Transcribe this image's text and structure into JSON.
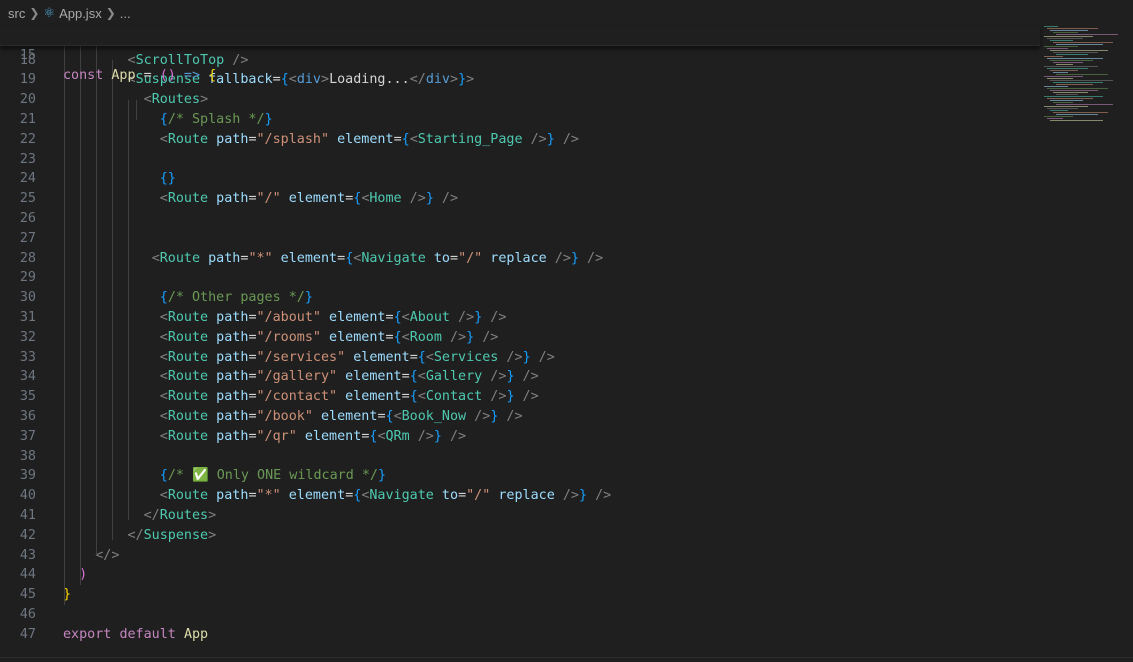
{
  "breadcrumb": {
    "folder": "src",
    "file": "App.jsx",
    "more": "...",
    "file_icon": "react-icon"
  },
  "sticky": {
    "number": "15",
    "tokens": [
      {
        "t": "const ",
        "c": "kw2"
      },
      {
        "t": "App",
        "c": "id"
      },
      {
        "t": " = ",
        "c": "txt"
      },
      {
        "t": "()",
        "c": "b2"
      },
      {
        "t": " => ",
        "c": "kw"
      },
      {
        "t": "{",
        "c": "b1"
      }
    ]
  },
  "lines": [
    {
      "n": "18",
      "tokens": [
        {
          "t": "        ",
          "c": "txt"
        },
        {
          "t": "<",
          "c": "tag"
        },
        {
          "t": "ScrollToTop",
          "c": "comp"
        },
        {
          "t": " />",
          "c": "tag"
        }
      ]
    },
    {
      "n": "19",
      "tokens": [
        {
          "t": "        ",
          "c": "txt"
        },
        {
          "t": "<",
          "c": "tag"
        },
        {
          "t": "Suspense",
          "c": "comp"
        },
        {
          "t": " fallback",
          "c": "attr"
        },
        {
          "t": "=",
          "c": "txt"
        },
        {
          "t": "{",
          "c": "b3"
        },
        {
          "t": "<",
          "c": "tag"
        },
        {
          "t": "div",
          "c": "kw"
        },
        {
          "t": ">",
          "c": "tag"
        },
        {
          "t": "Loading...",
          "c": "txt"
        },
        {
          "t": "</",
          "c": "tag"
        },
        {
          "t": "div",
          "c": "kw"
        },
        {
          "t": ">",
          "c": "tag"
        },
        {
          "t": "}",
          "c": "b3"
        },
        {
          "t": ">",
          "c": "tag"
        }
      ]
    },
    {
      "n": "20",
      "tokens": [
        {
          "t": "          ",
          "c": "txt"
        },
        {
          "t": "<",
          "c": "tag"
        },
        {
          "t": "Routes",
          "c": "comp"
        },
        {
          "t": ">",
          "c": "tag"
        }
      ]
    },
    {
      "n": "21",
      "tokens": [
        {
          "t": "            ",
          "c": "txt"
        },
        {
          "t": "{",
          "c": "b3"
        },
        {
          "t": "/* Splash */",
          "c": "cmt"
        },
        {
          "t": "}",
          "c": "b3"
        }
      ]
    },
    {
      "n": "22",
      "tokens": [
        {
          "t": "            ",
          "c": "txt"
        },
        {
          "t": "<",
          "c": "tag"
        },
        {
          "t": "Route",
          "c": "comp"
        },
        {
          "t": " path",
          "c": "attr"
        },
        {
          "t": "=",
          "c": "txt"
        },
        {
          "t": "\"/splash\"",
          "c": "str"
        },
        {
          "t": " element",
          "c": "attr"
        },
        {
          "t": "=",
          "c": "txt"
        },
        {
          "t": "{",
          "c": "b3"
        },
        {
          "t": "<",
          "c": "tag"
        },
        {
          "t": "Starting_Page",
          "c": "comp"
        },
        {
          "t": " />",
          "c": "tag"
        },
        {
          "t": "}",
          "c": "b3"
        },
        {
          "t": " />",
          "c": "tag"
        }
      ]
    },
    {
      "n": "23",
      "tokens": []
    },
    {
      "n": "24",
      "tokens": [
        {
          "t": "            ",
          "c": "txt"
        },
        {
          "t": "{}",
          "c": "b3"
        }
      ]
    },
    {
      "n": "25",
      "tokens": [
        {
          "t": "            ",
          "c": "txt"
        },
        {
          "t": "<",
          "c": "tag"
        },
        {
          "t": "Route",
          "c": "comp"
        },
        {
          "t": " path",
          "c": "attr"
        },
        {
          "t": "=",
          "c": "txt"
        },
        {
          "t": "\"/\"",
          "c": "str"
        },
        {
          "t": " element",
          "c": "attr"
        },
        {
          "t": "=",
          "c": "txt"
        },
        {
          "t": "{",
          "c": "b3"
        },
        {
          "t": "<",
          "c": "tag"
        },
        {
          "t": "Home",
          "c": "comp"
        },
        {
          "t": " />",
          "c": "tag"
        },
        {
          "t": "}",
          "c": "b3"
        },
        {
          "t": " />",
          "c": "tag"
        }
      ]
    },
    {
      "n": "26",
      "tokens": []
    },
    {
      "n": "27",
      "tokens": []
    },
    {
      "n": "28",
      "tokens": [
        {
          "t": "           ",
          "c": "txt"
        },
        {
          "t": "<",
          "c": "tag"
        },
        {
          "t": "Route",
          "c": "comp"
        },
        {
          "t": " path",
          "c": "attr"
        },
        {
          "t": "=",
          "c": "txt"
        },
        {
          "t": "\"*\"",
          "c": "str"
        },
        {
          "t": " element",
          "c": "attr"
        },
        {
          "t": "=",
          "c": "txt"
        },
        {
          "t": "{",
          "c": "b3"
        },
        {
          "t": "<",
          "c": "tag"
        },
        {
          "t": "Navigate",
          "c": "comp"
        },
        {
          "t": " to",
          "c": "attr"
        },
        {
          "t": "=",
          "c": "txt"
        },
        {
          "t": "\"/\"",
          "c": "str"
        },
        {
          "t": " replace",
          "c": "attr"
        },
        {
          "t": " />",
          "c": "tag"
        },
        {
          "t": "}",
          "c": "b3"
        },
        {
          "t": " />",
          "c": "tag"
        }
      ]
    },
    {
      "n": "29",
      "tokens": []
    },
    {
      "n": "30",
      "tokens": [
        {
          "t": "            ",
          "c": "txt"
        },
        {
          "t": "{",
          "c": "b3"
        },
        {
          "t": "/* Other pages */",
          "c": "cmt"
        },
        {
          "t": "}",
          "c": "b3"
        }
      ]
    },
    {
      "n": "31",
      "tokens": [
        {
          "t": "            ",
          "c": "txt"
        },
        {
          "t": "<",
          "c": "tag"
        },
        {
          "t": "Route",
          "c": "comp"
        },
        {
          "t": " path",
          "c": "attr"
        },
        {
          "t": "=",
          "c": "txt"
        },
        {
          "t": "\"/about\"",
          "c": "str"
        },
        {
          "t": " element",
          "c": "attr"
        },
        {
          "t": "=",
          "c": "txt"
        },
        {
          "t": "{",
          "c": "b3"
        },
        {
          "t": "<",
          "c": "tag"
        },
        {
          "t": "About",
          "c": "comp"
        },
        {
          "t": " />",
          "c": "tag"
        },
        {
          "t": "}",
          "c": "b3"
        },
        {
          "t": " />",
          "c": "tag"
        }
      ]
    },
    {
      "n": "32",
      "tokens": [
        {
          "t": "            ",
          "c": "txt"
        },
        {
          "t": "<",
          "c": "tag"
        },
        {
          "t": "Route",
          "c": "comp"
        },
        {
          "t": " path",
          "c": "attr"
        },
        {
          "t": "=",
          "c": "txt"
        },
        {
          "t": "\"/rooms\"",
          "c": "str"
        },
        {
          "t": " element",
          "c": "attr"
        },
        {
          "t": "=",
          "c": "txt"
        },
        {
          "t": "{",
          "c": "b3"
        },
        {
          "t": "<",
          "c": "tag"
        },
        {
          "t": "Room",
          "c": "comp"
        },
        {
          "t": " />",
          "c": "tag"
        },
        {
          "t": "}",
          "c": "b3"
        },
        {
          "t": " />",
          "c": "tag"
        }
      ]
    },
    {
      "n": "33",
      "tokens": [
        {
          "t": "            ",
          "c": "txt"
        },
        {
          "t": "<",
          "c": "tag"
        },
        {
          "t": "Route",
          "c": "comp"
        },
        {
          "t": " path",
          "c": "attr"
        },
        {
          "t": "=",
          "c": "txt"
        },
        {
          "t": "\"/services\"",
          "c": "str"
        },
        {
          "t": " element",
          "c": "attr"
        },
        {
          "t": "=",
          "c": "txt"
        },
        {
          "t": "{",
          "c": "b3"
        },
        {
          "t": "<",
          "c": "tag"
        },
        {
          "t": "Services",
          "c": "comp"
        },
        {
          "t": " />",
          "c": "tag"
        },
        {
          "t": "}",
          "c": "b3"
        },
        {
          "t": " />",
          "c": "tag"
        }
      ]
    },
    {
      "n": "34",
      "tokens": [
        {
          "t": "            ",
          "c": "txt"
        },
        {
          "t": "<",
          "c": "tag"
        },
        {
          "t": "Route",
          "c": "comp"
        },
        {
          "t": " path",
          "c": "attr"
        },
        {
          "t": "=",
          "c": "txt"
        },
        {
          "t": "\"/gallery\"",
          "c": "str"
        },
        {
          "t": " element",
          "c": "attr"
        },
        {
          "t": "=",
          "c": "txt"
        },
        {
          "t": "{",
          "c": "b3"
        },
        {
          "t": "<",
          "c": "tag"
        },
        {
          "t": "Gallery",
          "c": "comp"
        },
        {
          "t": " />",
          "c": "tag"
        },
        {
          "t": "}",
          "c": "b3"
        },
        {
          "t": " />",
          "c": "tag"
        }
      ]
    },
    {
      "n": "35",
      "tokens": [
        {
          "t": "            ",
          "c": "txt"
        },
        {
          "t": "<",
          "c": "tag"
        },
        {
          "t": "Route",
          "c": "comp"
        },
        {
          "t": " path",
          "c": "attr"
        },
        {
          "t": "=",
          "c": "txt"
        },
        {
          "t": "\"/contact\"",
          "c": "str"
        },
        {
          "t": " element",
          "c": "attr"
        },
        {
          "t": "=",
          "c": "txt"
        },
        {
          "t": "{",
          "c": "b3"
        },
        {
          "t": "<",
          "c": "tag"
        },
        {
          "t": "Contact",
          "c": "comp"
        },
        {
          "t": " />",
          "c": "tag"
        },
        {
          "t": "}",
          "c": "b3"
        },
        {
          "t": " />",
          "c": "tag"
        }
      ]
    },
    {
      "n": "36",
      "tokens": [
        {
          "t": "            ",
          "c": "txt"
        },
        {
          "t": "<",
          "c": "tag"
        },
        {
          "t": "Route",
          "c": "comp"
        },
        {
          "t": " path",
          "c": "attr"
        },
        {
          "t": "=",
          "c": "txt"
        },
        {
          "t": "\"/book\"",
          "c": "str"
        },
        {
          "t": " element",
          "c": "attr"
        },
        {
          "t": "=",
          "c": "txt"
        },
        {
          "t": "{",
          "c": "b3"
        },
        {
          "t": "<",
          "c": "tag"
        },
        {
          "t": "Book_Now",
          "c": "comp"
        },
        {
          "t": " />",
          "c": "tag"
        },
        {
          "t": "}",
          "c": "b3"
        },
        {
          "t": " />",
          "c": "tag"
        }
      ]
    },
    {
      "n": "37",
      "tokens": [
        {
          "t": "            ",
          "c": "txt"
        },
        {
          "t": "<",
          "c": "tag"
        },
        {
          "t": "Route",
          "c": "comp"
        },
        {
          "t": " path",
          "c": "attr"
        },
        {
          "t": "=",
          "c": "txt"
        },
        {
          "t": "\"/qr\"",
          "c": "str"
        },
        {
          "t": " element",
          "c": "attr"
        },
        {
          "t": "=",
          "c": "txt"
        },
        {
          "t": "{",
          "c": "b3"
        },
        {
          "t": "<",
          "c": "tag"
        },
        {
          "t": "QRm",
          "c": "comp"
        },
        {
          "t": " />",
          "c": "tag"
        },
        {
          "t": "}",
          "c": "b3"
        },
        {
          "t": " />",
          "c": "tag"
        }
      ]
    },
    {
      "n": "38",
      "tokens": []
    },
    {
      "n": "39",
      "tokens": [
        {
          "t": "            ",
          "c": "txt"
        },
        {
          "t": "{",
          "c": "b3"
        },
        {
          "t": "/* ✅ Only ONE wildcard */",
          "c": "cmt"
        },
        {
          "t": "}",
          "c": "b3"
        }
      ]
    },
    {
      "n": "40",
      "tokens": [
        {
          "t": "            ",
          "c": "txt"
        },
        {
          "t": "<",
          "c": "tag"
        },
        {
          "t": "Route",
          "c": "comp"
        },
        {
          "t": " path",
          "c": "attr"
        },
        {
          "t": "=",
          "c": "txt"
        },
        {
          "t": "\"*\"",
          "c": "str"
        },
        {
          "t": " element",
          "c": "attr"
        },
        {
          "t": "=",
          "c": "txt"
        },
        {
          "t": "{",
          "c": "b3"
        },
        {
          "t": "<",
          "c": "tag"
        },
        {
          "t": "Navigate",
          "c": "comp"
        },
        {
          "t": " to",
          "c": "attr"
        },
        {
          "t": "=",
          "c": "txt"
        },
        {
          "t": "\"/\"",
          "c": "str"
        },
        {
          "t": " replace",
          "c": "attr"
        },
        {
          "t": " />",
          "c": "tag"
        },
        {
          "t": "}",
          "c": "b3"
        },
        {
          "t": " />",
          "c": "tag"
        }
      ]
    },
    {
      "n": "41",
      "tokens": [
        {
          "t": "          ",
          "c": "txt"
        },
        {
          "t": "</",
          "c": "tag"
        },
        {
          "t": "Routes",
          "c": "comp"
        },
        {
          "t": ">",
          "c": "tag"
        }
      ]
    },
    {
      "n": "42",
      "tokens": [
        {
          "t": "        ",
          "c": "txt"
        },
        {
          "t": "</",
          "c": "tag"
        },
        {
          "t": "Suspense",
          "c": "comp"
        },
        {
          "t": ">",
          "c": "tag"
        }
      ]
    },
    {
      "n": "43",
      "tokens": [
        {
          "t": "    ",
          "c": "txt"
        },
        {
          "t": "</>",
          "c": "tag"
        }
      ]
    },
    {
      "n": "44",
      "tokens": [
        {
          "t": "  ",
          "c": "txt"
        },
        {
          "t": ")",
          "c": "b2"
        }
      ]
    },
    {
      "n": "45",
      "tokens": [
        {
          "t": "}",
          "c": "b1"
        }
      ]
    },
    {
      "n": "46",
      "tokens": []
    },
    {
      "n": "47",
      "tokens": [
        {
          "t": "export ",
          "c": "kw2"
        },
        {
          "t": "default ",
          "c": "kw2"
        },
        {
          "t": "App",
          "c": "id"
        }
      ]
    }
  ],
  "colors": {
    "background": "#1f1f1f",
    "line_number": "#6e7681",
    "component": "#4ec9b0",
    "string": "#ce9178",
    "comment": "#6a9955",
    "keyword": "#c586c0",
    "function": "#dcdcaa",
    "bracket_gold": "#ffd700",
    "bracket_purple": "#da70d6",
    "bracket_blue": "#179fff"
  }
}
